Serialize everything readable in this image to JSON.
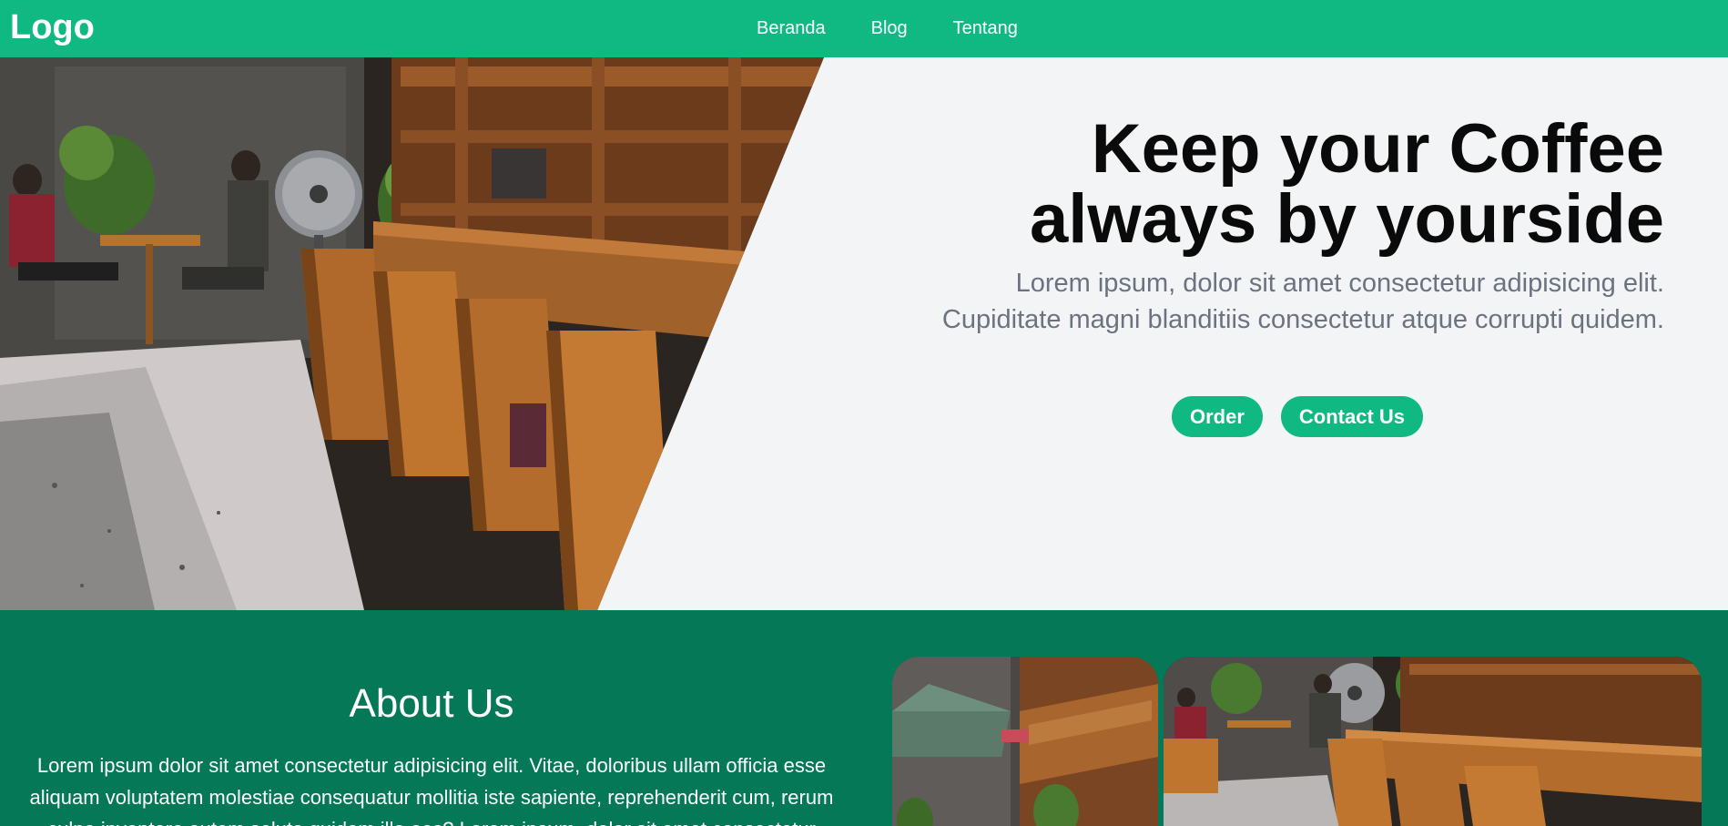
{
  "navbar": {
    "logo": "Logo",
    "links": [
      "Beranda",
      "Blog",
      "Tentang"
    ]
  },
  "hero": {
    "title_line1": "Keep your Coffee",
    "title_line2": "always by yourside",
    "subtitle_line1": "Lorem ipsum, dolor sit amet consectetur adipisicing elit.",
    "subtitle_line2": "Cupiditate magni blanditiis consectetur atque corrupti quidem.",
    "buttons": {
      "order": "Order",
      "contact": "Contact Us"
    },
    "image_description": "coffee-shop-interior-photo"
  },
  "about": {
    "title": "About Us",
    "text": "Lorem ipsum dolor sit amet consectetur adipisicing elit. Vitae, doloribus ullam officia esse aliquam voluptatem molestiae consequatur mollitia iste sapiente, reprehenderit cum, rerum culpa inventore autem soluta quidem illo eos? Lorem ipsum, dolor sit amet consectetur"
  },
  "colors": {
    "brand": "#10b981",
    "about_bg": "#047857",
    "hero_bg": "#f3f4f6",
    "title": "#0a0a0a",
    "subtitle": "#6b7280"
  }
}
